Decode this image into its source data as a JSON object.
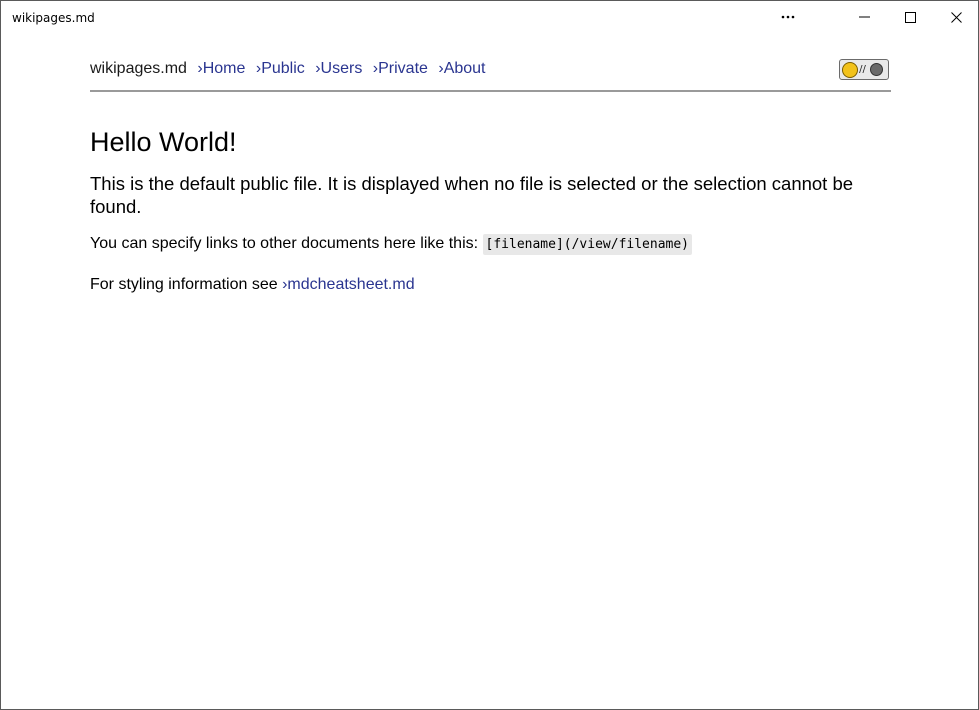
{
  "window": {
    "title": "wikipages.md"
  },
  "icons": {
    "more": "more-horizontal-icon",
    "minimize": "minimize-icon",
    "maximize": "maximize-icon",
    "close": "close-icon",
    "sun": "sun-icon",
    "moon": "moon-icon"
  },
  "nav": {
    "brand": "wikipages.md",
    "links": [
      {
        "label": "›Home"
      },
      {
        "label": "›Public"
      },
      {
        "label": "›Users"
      },
      {
        "label": "›Private"
      },
      {
        "label": "›About"
      }
    ],
    "theme_separator": "//"
  },
  "main": {
    "heading": "Hello World!",
    "lead": "This is the default public file. It is displayed when no file is selected or the selection cannot be found.",
    "links_text": "You can specify links to other documents here like this:",
    "links_code": "[filename](/view/filename)",
    "styling_text": "For styling information see",
    "styling_link": "›mdcheatsheet.md"
  },
  "colors": {
    "link": "#2a3590",
    "divider": "#9a9a9a",
    "code_bg": "#e8e8e8"
  }
}
